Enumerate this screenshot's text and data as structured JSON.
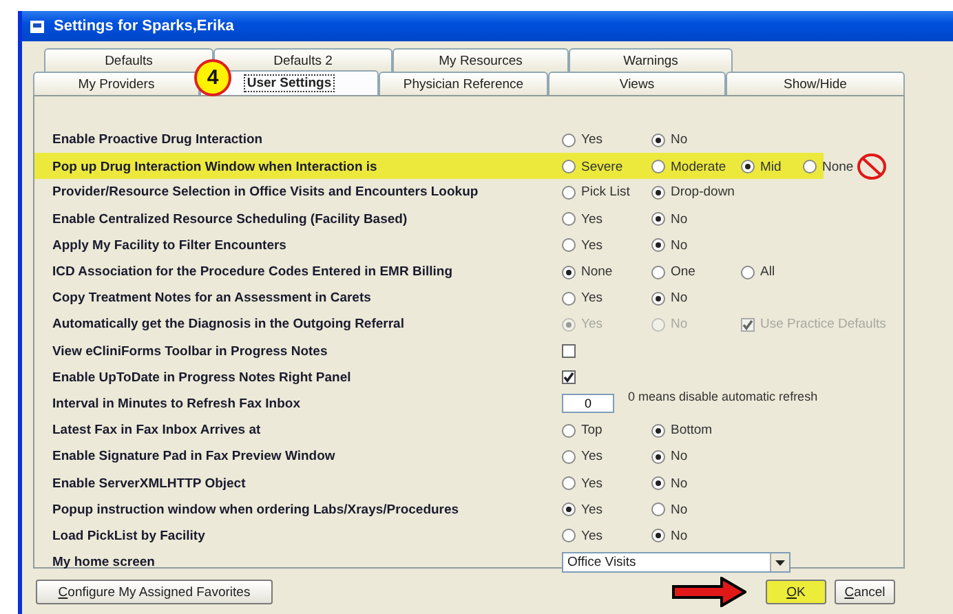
{
  "window": {
    "title": "Settings for Sparks,Erika"
  },
  "tabs_back": [
    {
      "label": "Defaults",
      "selected": false
    },
    {
      "label": "Defaults 2",
      "selected": false
    },
    {
      "label": "My Resources",
      "selected": false
    },
    {
      "label": "Warnings",
      "selected": false
    }
  ],
  "tabs_front": [
    {
      "label": "My Providers",
      "selected": false
    },
    {
      "label": "User Settings",
      "selected": true
    },
    {
      "label": "Physician Reference",
      "selected": false
    },
    {
      "label": "Views",
      "selected": false
    },
    {
      "label": "Show/Hide",
      "selected": false
    }
  ],
  "step_badge": "4",
  "settings": [
    {
      "label": "Enable Proactive Drug Interaction",
      "kind": "options",
      "highlighted": false,
      "disabled": false,
      "options": [
        {
          "kind": "radio",
          "label": "Yes",
          "selected": false,
          "struck": false
        },
        {
          "kind": "radio",
          "label": "No",
          "selected": true,
          "struck": false
        }
      ]
    },
    {
      "label": "Pop up Drug Interaction Window when Interaction is",
      "kind": "options",
      "highlighted": true,
      "disabled": false,
      "options": [
        {
          "kind": "radio",
          "label": "Severe",
          "selected": false,
          "struck": false
        },
        {
          "kind": "radio",
          "label": "Moderate",
          "selected": false,
          "struck": false
        },
        {
          "kind": "radio",
          "label": "Mid",
          "selected": true,
          "struck": false
        },
        {
          "kind": "radio",
          "label": "None",
          "selected": false,
          "struck": true
        }
      ]
    },
    {
      "label": "Provider/Resource Selection in Office Visits and Encounters Lookup",
      "kind": "options",
      "highlighted": false,
      "disabled": false,
      "options": [
        {
          "kind": "radio",
          "label": "Pick List",
          "selected": false,
          "struck": false
        },
        {
          "kind": "radio",
          "label": "Drop-down",
          "selected": true,
          "struck": false
        }
      ]
    },
    {
      "label": "Enable Centralized Resource Scheduling (Facility Based)",
      "kind": "options",
      "highlighted": false,
      "disabled": false,
      "options": [
        {
          "kind": "radio",
          "label": "Yes",
          "selected": false,
          "struck": false
        },
        {
          "kind": "radio",
          "label": "No",
          "selected": true,
          "struck": false
        }
      ]
    },
    {
      "label": "Apply My Facility to Filter Encounters",
      "kind": "options",
      "highlighted": false,
      "disabled": false,
      "options": [
        {
          "kind": "radio",
          "label": "Yes",
          "selected": false,
          "struck": false
        },
        {
          "kind": "radio",
          "label": "No",
          "selected": true,
          "struck": false
        }
      ]
    },
    {
      "label": "ICD Association for the Procedure Codes Entered in EMR Billing",
      "kind": "options",
      "highlighted": false,
      "disabled": false,
      "options": [
        {
          "kind": "radio",
          "label": "None",
          "selected": true,
          "struck": false
        },
        {
          "kind": "radio",
          "label": "One",
          "selected": false,
          "struck": false
        },
        {
          "kind": "radio",
          "label": "All",
          "selected": false,
          "struck": false
        }
      ]
    },
    {
      "label": "Copy Treatment Notes for an Assessment in Carets",
      "kind": "options",
      "highlighted": false,
      "disabled": false,
      "options": [
        {
          "kind": "radio",
          "label": "Yes",
          "selected": false,
          "struck": false
        },
        {
          "kind": "radio",
          "label": "No",
          "selected": true,
          "struck": false
        }
      ]
    },
    {
      "label": "Automatically get the Diagnosis in the Outgoing Referral",
      "kind": "options",
      "highlighted": false,
      "disabled": true,
      "options": [
        {
          "kind": "radio",
          "label": "Yes",
          "selected": true,
          "struck": false
        },
        {
          "kind": "radio",
          "label": "No",
          "selected": false,
          "struck": false
        },
        {
          "kind": "checkbox",
          "label": "Use Practice Defaults",
          "selected": true,
          "struck": false
        }
      ]
    },
    {
      "label": "View eCliniForms Toolbar in Progress Notes",
      "kind": "checkbox",
      "highlighted": false,
      "checked": false
    },
    {
      "label": "Enable UpToDate in Progress Notes Right Panel",
      "kind": "checkbox",
      "highlighted": false,
      "checked": true
    },
    {
      "label": "Interval in Minutes to Refresh Fax Inbox",
      "kind": "number",
      "highlighted": false,
      "value": "0",
      "note": "0 means disable automatic refresh"
    },
    {
      "label": "Latest Fax in Fax Inbox Arrives at",
      "kind": "options",
      "highlighted": false,
      "disabled": false,
      "options": [
        {
          "kind": "radio",
          "label": "Top",
          "selected": false,
          "struck": false
        },
        {
          "kind": "radio",
          "label": "Bottom",
          "selected": true,
          "struck": false
        }
      ]
    },
    {
      "label": "Enable Signature Pad in Fax Preview Window",
      "kind": "options",
      "highlighted": false,
      "disabled": false,
      "options": [
        {
          "kind": "radio",
          "label": "Yes",
          "selected": false,
          "struck": false
        },
        {
          "kind": "radio",
          "label": "No",
          "selected": true,
          "struck": false
        }
      ]
    },
    {
      "label": "Enable ServerXMLHTTP Object",
      "kind": "options",
      "highlighted": false,
      "disabled": false,
      "options": [
        {
          "kind": "radio",
          "label": "Yes",
          "selected": false,
          "struck": false
        },
        {
          "kind": "radio",
          "label": "No",
          "selected": true,
          "struck": false
        }
      ]
    },
    {
      "label": "Popup instruction window when ordering Labs/Xrays/Procedures",
      "kind": "options",
      "highlighted": false,
      "disabled": false,
      "options": [
        {
          "kind": "radio",
          "label": "Yes",
          "selected": true,
          "struck": false
        },
        {
          "kind": "radio",
          "label": "No",
          "selected": false,
          "struck": false
        }
      ]
    },
    {
      "label": "Load PickList by Facility",
      "kind": "options",
      "highlighted": false,
      "disabled": false,
      "options": [
        {
          "kind": "radio",
          "label": "Yes",
          "selected": false,
          "struck": false
        },
        {
          "kind": "radio",
          "label": "No",
          "selected": true,
          "struck": false
        }
      ]
    },
    {
      "label": "My home screen",
      "kind": "dropdown",
      "highlighted": false,
      "value": "Office Visits"
    }
  ],
  "configure_button": "Configure My Assigned Favorites",
  "buttons": [
    {
      "label": "OK",
      "highlighted": true
    },
    {
      "label": "Cancel",
      "highlighted": false
    }
  ]
}
